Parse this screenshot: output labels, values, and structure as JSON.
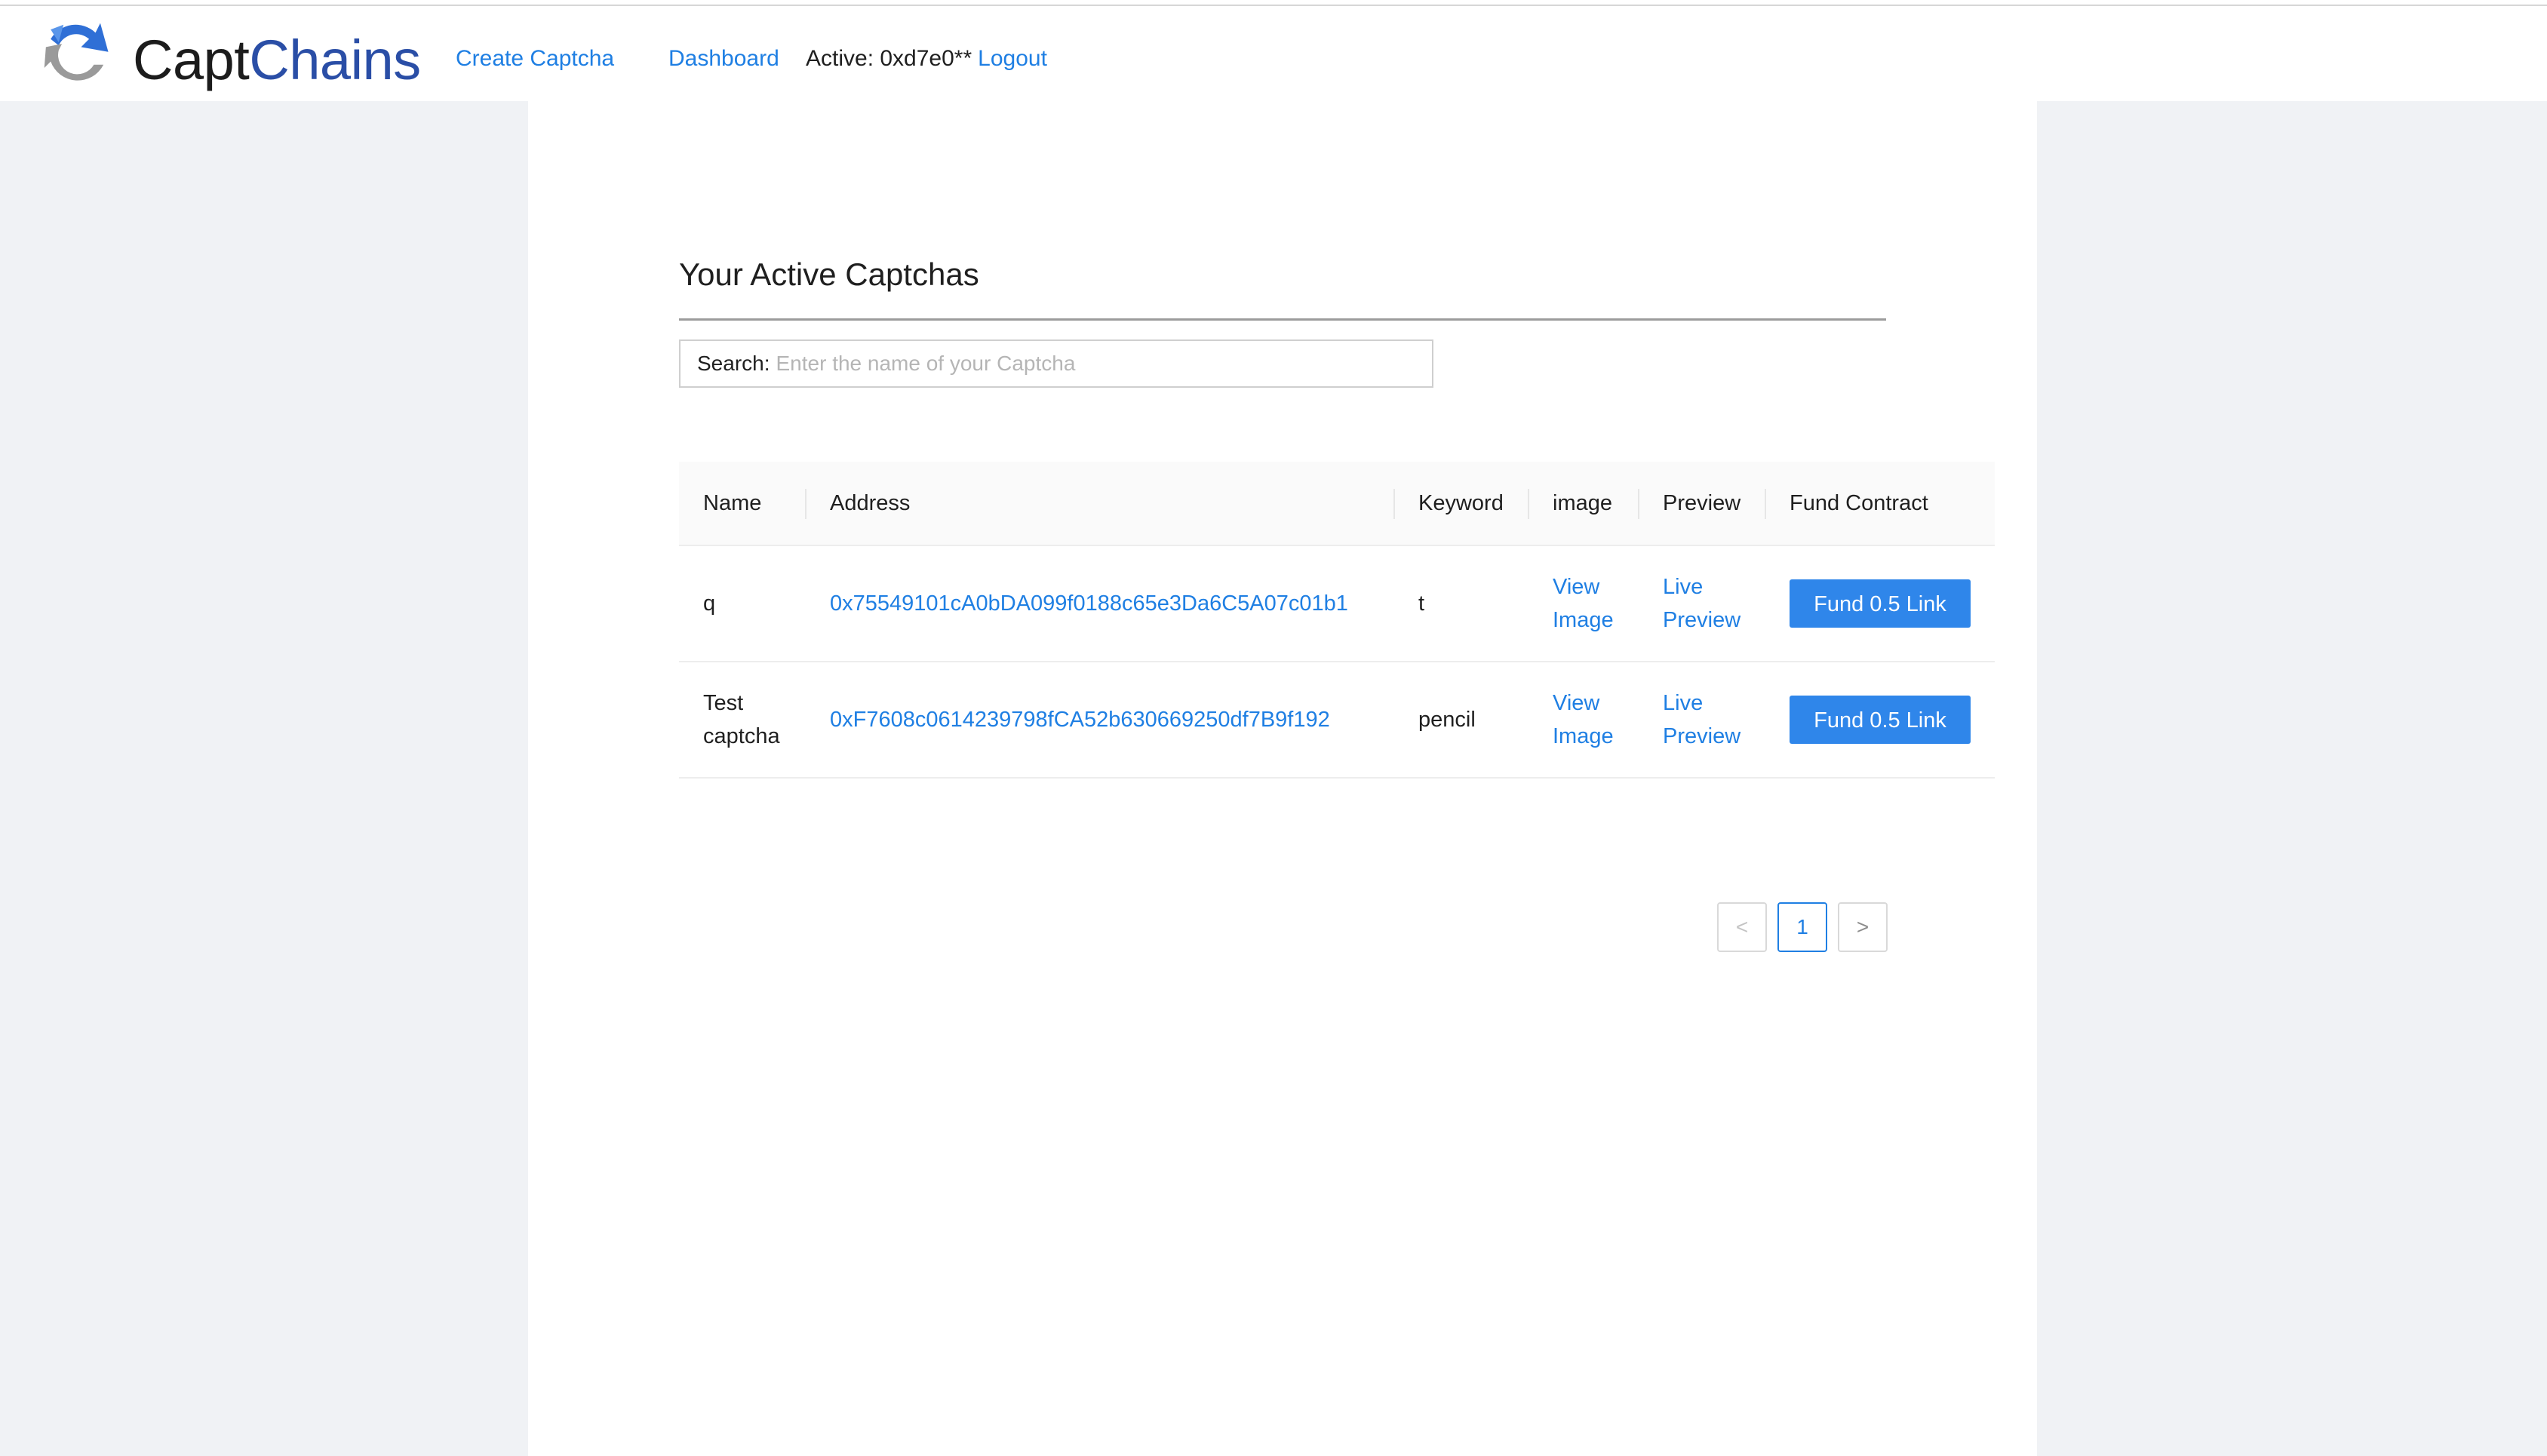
{
  "header": {
    "brand_part1": "Capt",
    "brand_part2": "Chains",
    "nav": {
      "create": "Create Captcha",
      "dashboard": "Dashboard"
    },
    "active_label": "Active: 0xd7e0**",
    "logout": "Logout"
  },
  "main": {
    "title": "Your Active Captchas",
    "search": {
      "label": "Search:",
      "placeholder": "Enter the name of your Captcha",
      "value": ""
    },
    "table": {
      "columns": [
        "Name",
        "Address",
        "Keyword",
        "image",
        "Preview",
        "Fund Contract"
      ],
      "rows": [
        {
          "name": "q",
          "address": "0x75549101cA0bDA099f0188c65e3Da6C5A07c01b1",
          "keyword": "t",
          "image_link": [
            "View",
            "Image"
          ],
          "preview_link": [
            "Live",
            "Preview"
          ],
          "fund_button": "Fund 0.5 Link"
        },
        {
          "name": [
            "Test",
            "captcha"
          ],
          "address": "0xF7608c0614239798fCA52b630669250df7B9f192",
          "keyword": "pencil",
          "image_link": [
            "View",
            "Image"
          ],
          "preview_link": [
            "Live",
            "Preview"
          ],
          "fund_button": "Fund 0.5 Link"
        }
      ]
    },
    "pagination": {
      "prev": "<",
      "current": "1",
      "next": ">"
    }
  },
  "colors": {
    "link": "#1f7fe3",
    "button": "#2f86ea",
    "brand_dark": "#2a4ea6"
  },
  "icons": {
    "logo": "captchains-recycle-logo-icon"
  }
}
